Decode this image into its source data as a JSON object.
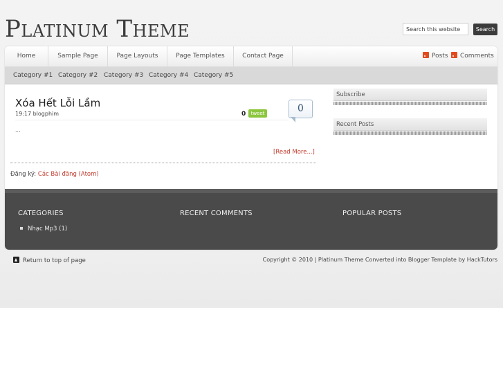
{
  "header": {
    "logo_text": "Platinum Theme",
    "search": {
      "placeholder": "Search this website",
      "value": "Search this website",
      "button_label": "Search"
    }
  },
  "nav": {
    "items": [
      "Home",
      "Sample Page",
      "Page Layouts",
      "Page Templates",
      "Contact Page"
    ],
    "feeds": {
      "posts": "Posts",
      "comments": "Comments"
    }
  },
  "subnav": {
    "categories": [
      "Category #1",
      "Category #2",
      "Category #3",
      "Category #4",
      "Category #5"
    ]
  },
  "post": {
    "title": "Xóa Hết Lỗi Lầm",
    "meta": "19:17 blogphim",
    "share_count": "0",
    "tweet_label": "tweet",
    "comment_count": "0",
    "excerpt": "...",
    "read_more": "[Read More...]"
  },
  "subscribe": {
    "label": "Đăng ký:",
    "link": "Các Bài đăng (Atom)"
  },
  "sidebar": {
    "widgets": [
      "Subscribe",
      "Recent Posts"
    ]
  },
  "footer": {
    "columns": [
      "CATEGORIES",
      "RECENT COMMENTS",
      "POPULAR POSTS"
    ],
    "categories": [
      "Nhạc Mp3 (1)"
    ]
  },
  "bottom": {
    "return_top": "Return to top of page",
    "copyright": "Copyright © 2010 | Platinum Theme Converted into Blogger Template by HackTutors"
  },
  "colors": {
    "accent": "#c0392b",
    "footer_bg": "#4a4a4a",
    "tweet": "#8cc63f",
    "rss": "#e24a1f"
  },
  "icons": [
    "rss-icon",
    "up-arrow-icon",
    "bullet-icon"
  ]
}
